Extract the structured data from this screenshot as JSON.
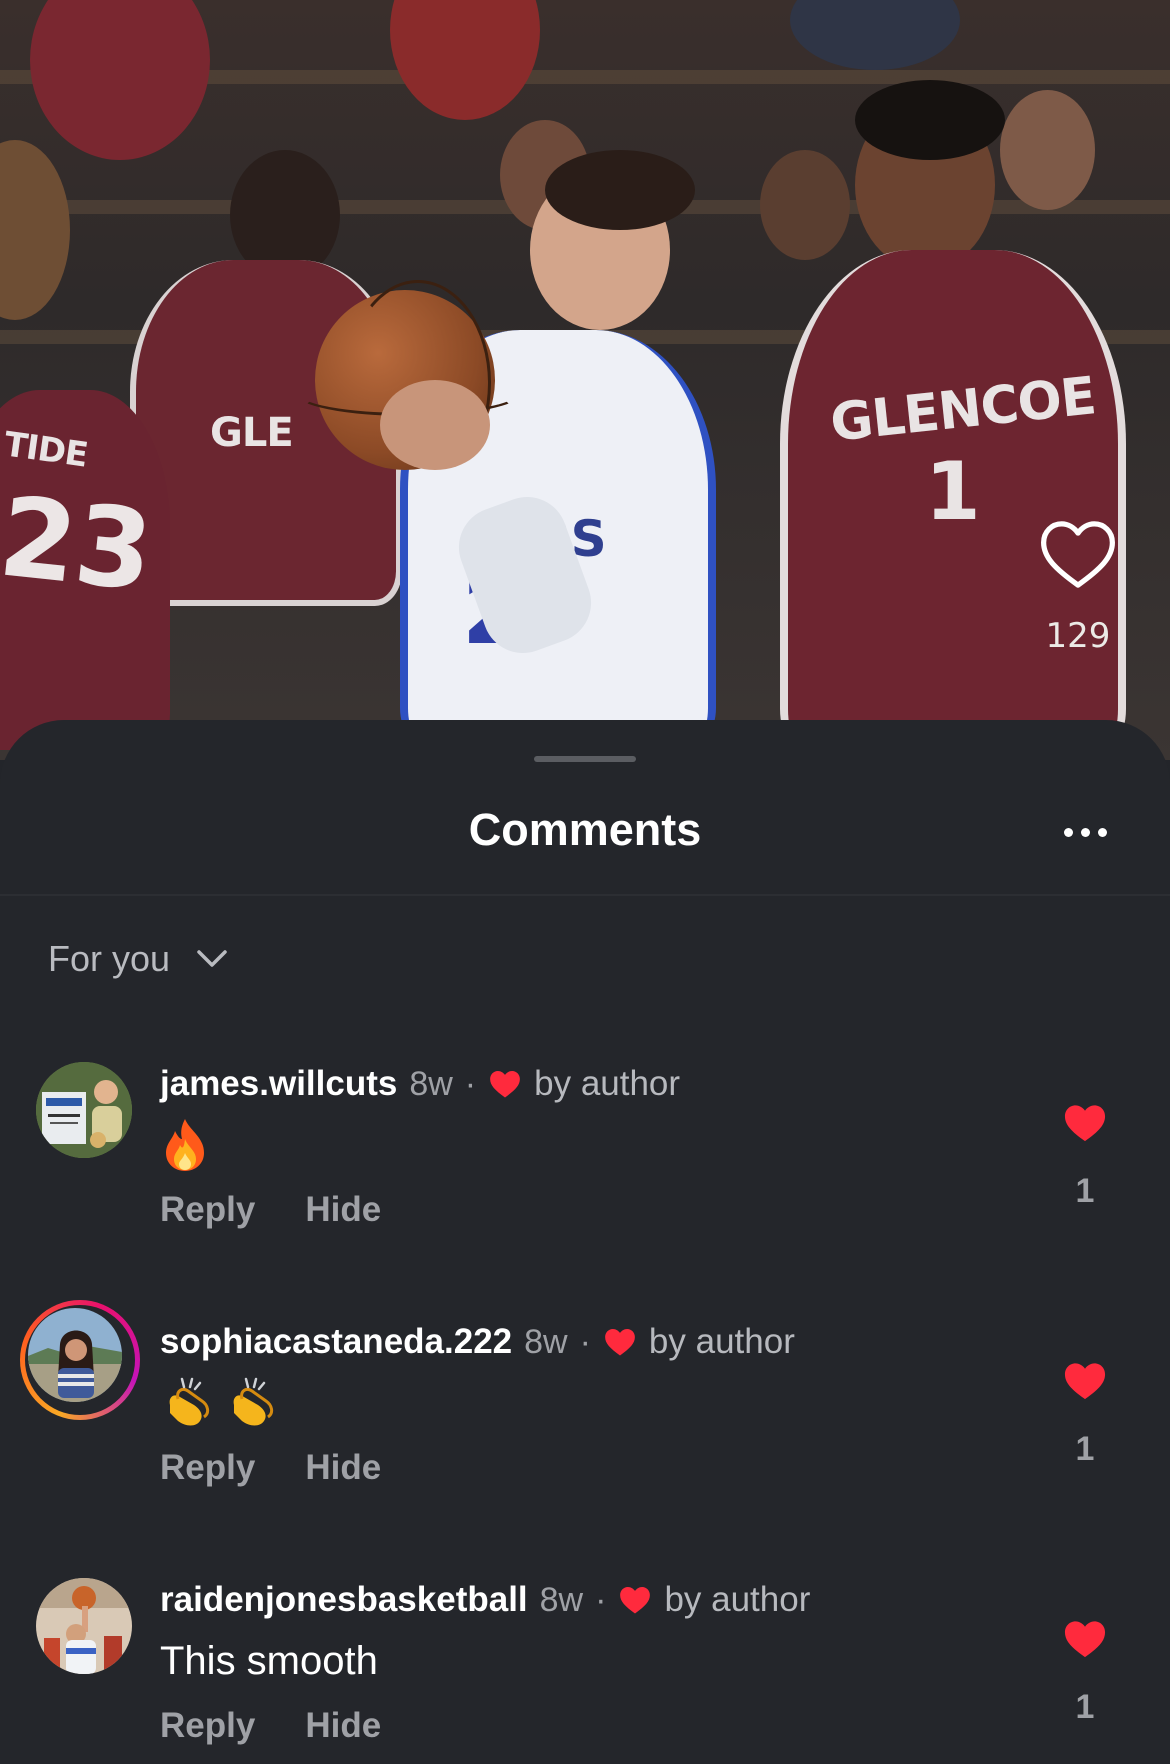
{
  "media": {
    "jersey_texts": [
      "GLENCOE",
      "1",
      "GLE",
      "TIDE",
      "23",
      "ERS",
      "2"
    ],
    "like_count": "129"
  },
  "sheet": {
    "title": "Comments",
    "filter_label": "For you"
  },
  "comments": [
    {
      "username": "james.willcuts",
      "age": "8w",
      "dot": "·",
      "by_author": "by author",
      "body_emoji": "fire",
      "reply_label": "Reply",
      "hide_label": "Hide",
      "like_count": "1"
    },
    {
      "username": "sophiacastaneda.222",
      "age": "8w",
      "dot": "·",
      "by_author": "by author",
      "body_emoji": "clapping-hands x2",
      "reply_label": "Reply",
      "hide_label": "Hide",
      "like_count": "1"
    },
    {
      "username": "raidenjonesbasketball",
      "age": "8w",
      "dot": "·",
      "by_author": "by author",
      "body": "This smooth",
      "reply_label": "Reply",
      "hide_label": "Hide",
      "like_count": "1"
    }
  ],
  "colors": {
    "sheet_background": "#24262b",
    "heart_red": "#ff2a3d",
    "muted_text": "#9fa1a6"
  }
}
